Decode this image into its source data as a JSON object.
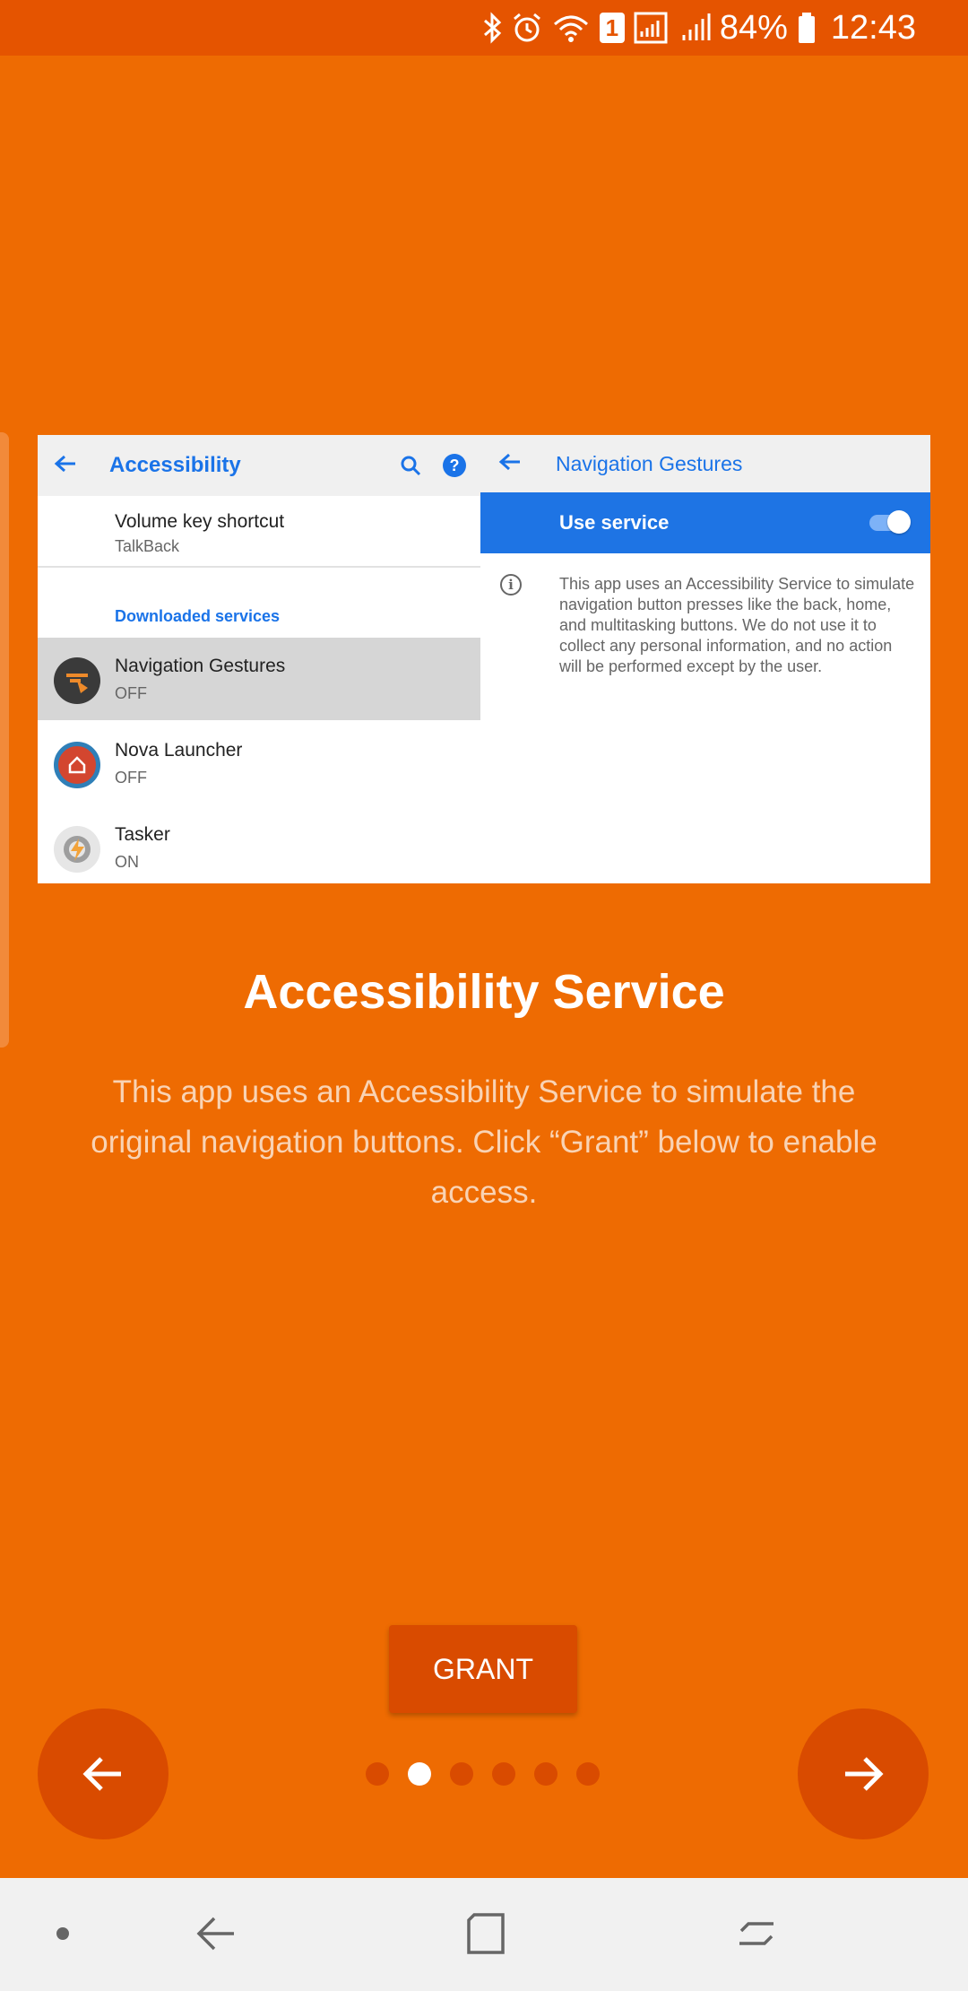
{
  "status_bar": {
    "battery": "84%",
    "time": "12:43",
    "sim_badge": "1"
  },
  "screenshot": {
    "left": {
      "title": "Accessibility",
      "volume_title": "Volume key shortcut",
      "volume_sub": "TalkBack",
      "section": "Downloaded services",
      "apps": [
        {
          "name": "Navigation Gestures",
          "status": "OFF"
        },
        {
          "name": "Nova Launcher",
          "status": "OFF"
        },
        {
          "name": "Tasker",
          "status": "ON"
        }
      ]
    },
    "right": {
      "title": "Navigation Gestures",
      "use_service": "Use service",
      "info": "This app uses an Accessibility Service to simulate navigation button presses like the back, home, and multitasking buttons. We do not use it to collect any personal information, and no action will be performed except by the user."
    }
  },
  "heading": "Accessibility Service",
  "description": "This app uses an Accessibility Service to simulate the original navigation buttons. Click “Grant” below to enable access.",
  "grant_label": "GRANT",
  "pager": {
    "count": 6,
    "active_index": 1
  },
  "colors": {
    "background": "#EE6B02",
    "status_bar": "#E55400",
    "accent_dark": "#D94B00",
    "link_blue": "#1A73E8"
  }
}
